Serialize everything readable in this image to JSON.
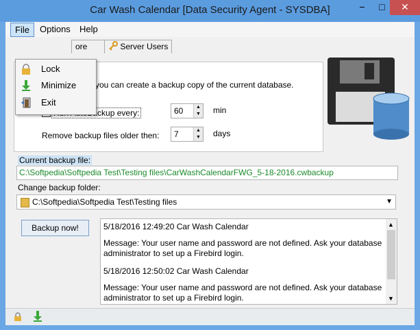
{
  "window": {
    "title": "Car Wash Calendar [Data Security Agent - SYSDBA]",
    "minimize": "−",
    "maximize": "□",
    "close": "✕"
  },
  "menubar": {
    "file": "File",
    "options": "Options",
    "help": "Help"
  },
  "file_menu": {
    "items": [
      {
        "label": "Lock",
        "icon": "lock-icon"
      },
      {
        "label": "Minimize",
        "icon": "minimize-arrow-icon"
      },
      {
        "label": "Exit",
        "icon": "exit-door-icon"
      }
    ]
  },
  "tabs": {
    "restore_fragment": "ore",
    "server_users": "Server Users"
  },
  "backup_panel": {
    "intro": "you can create a backup copy of the current database.",
    "autobackup_label": "Run AutoBackup every:",
    "autobackup_checked": true,
    "autobackup_value": "60",
    "autobackup_unit": "min",
    "remove_label": "Remove backup files older then:",
    "remove_value": "7",
    "remove_unit": "days"
  },
  "current_backup": {
    "label": "Current backup file:",
    "path": "C:\\Softpedia\\Softpedia Test\\Testing files\\CarWashCalendarFWG_5-18-2016.cwbackup"
  },
  "change_folder": {
    "label": "Change backup folder:",
    "value": "C:\\Softpedia\\Softpedia Test\\Testing files"
  },
  "backup_button": "Backup now!",
  "log": {
    "entries": [
      "5/18/2016 12:49:20 Car Wash Calendar",
      "Message: Your user name and password are not defined. Ask your database",
      "administrator to set up a Firebird login.",
      "5/18/2016 12:50:02 Car Wash Calendar",
      "Message: Your user name and password are not defined. Ask your database",
      "administrator to set up a Firebird login."
    ]
  },
  "colors": {
    "titlebar": "#5b9cdf",
    "path_green": "#1a8a2a",
    "close_red": "#c75050"
  }
}
